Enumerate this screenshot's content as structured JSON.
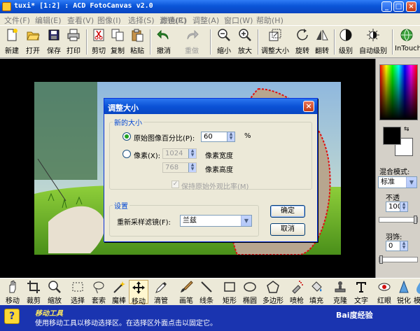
{
  "window": {
    "title": "tuxi* [1:2] : ACD FotoCanvas v2.0",
    "controls": {
      "minimize": "_",
      "maximize": "□",
      "close": "×"
    }
  },
  "menu": [
    "文件(F)",
    "编辑(E)",
    "查看(V)",
    "图像(I)",
    "选择(S)",
    "滤镜(R)",
    "颜色(C)",
    "调整(A)",
    "窗口(W)",
    "帮助(H)"
  ],
  "toolbar": {
    "new": "新建",
    "open": "打开",
    "save": "保存",
    "print": "打印",
    "cut": "剪切",
    "copy": "复制",
    "paste": "粘贴",
    "undo": "撤消",
    "redo": "重做",
    "zoom_out": "缩小",
    "zoom_in": "放大",
    "resize": "调整大小",
    "rotate": "旋转",
    "flip": "翻转",
    "levels": "级别",
    "auto_levels": "自动级别",
    "intouch": "InTouch"
  },
  "panel": {
    "blend_mode_label": "混合模式:",
    "blend_mode_value": "标准",
    "opacity_label": "不透",
    "opacity_value": "100",
    "feather_label": "羽饰:",
    "feather_value": "0"
  },
  "dialog": {
    "title": "调整大小",
    "close": "×",
    "group_new_size": "新的大小",
    "radio_percent_label": "原始图像百分比(P):",
    "percent_value": "60",
    "percent_unit": "%",
    "radio_pixels_label": "像素(X):",
    "width_value": "1024",
    "width_label": "像素宽度",
    "height_value": "768",
    "height_label": "像素高度",
    "keep_aspect_label": "保持原始外观比率(M)",
    "keep_aspect_checked": true,
    "group_settings": "设置",
    "resample_label": "重新采样滤镜(F):",
    "resample_value": "兰兹",
    "ok": "确定",
    "cancel": "取消"
  },
  "tools": [
    "移动",
    "裁剪",
    "缩放",
    "选择",
    "套索",
    "魔棒",
    "移动",
    "滴管",
    "画笔",
    "线条",
    "矩形",
    "椭圆",
    "多边形",
    "喷枪",
    "填充",
    "克隆",
    "文字",
    "红眼",
    "锐化",
    "模糊"
  ],
  "active_tool_index": 6,
  "hint": {
    "title": "移动工具",
    "text": "使用移动工具以移动选择区。在选择区外面点击以固定它。",
    "watermark": "Bai度经验"
  },
  "colors": {
    "title_blue": "#0a55d8",
    "hint_bar": "#1a34b0",
    "legend_blue": "#0046d5",
    "selection_red": "#e01010"
  }
}
